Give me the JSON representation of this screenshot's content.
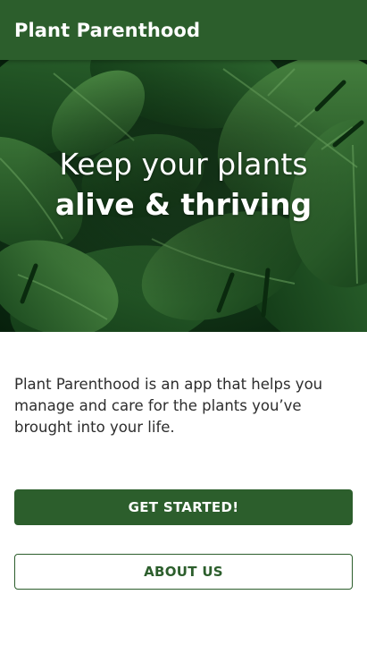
{
  "app_bar": {
    "title": "Plant Parenthood"
  },
  "hero": {
    "line1": "Keep your plants",
    "line2": "alive & thriving",
    "image": "monstera-leaves-photo"
  },
  "description": "Plant Parenthood is an app that helps you manage and care for the plants you’ve brought into your life.",
  "buttons": {
    "get_started": "GET STARTED!",
    "about_us": "ABOUT US"
  },
  "colors": {
    "primary": "#2c5e2c",
    "text": "#2d2d2d",
    "background": "#ffffff"
  }
}
